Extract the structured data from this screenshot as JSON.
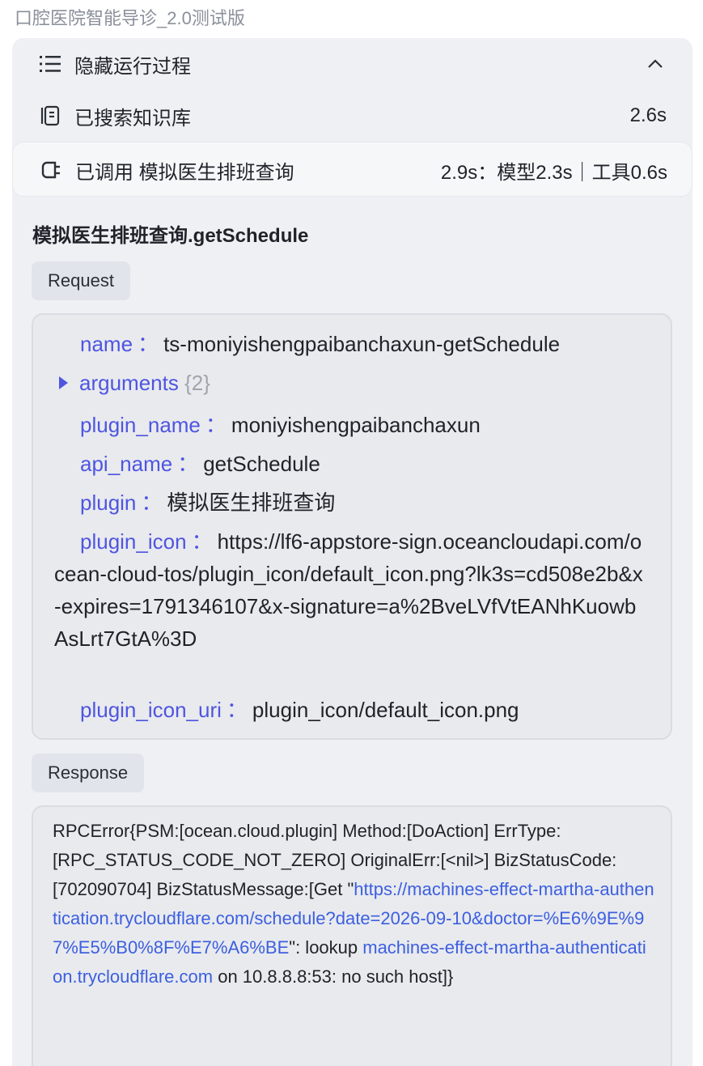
{
  "app": {
    "title": "口腔医院智能导诊_2.0测试版"
  },
  "process": {
    "hide_label": "隐藏运行过程",
    "search_label": "已搜索知识库",
    "search_time": "2.6s",
    "tool_call_label": "已调用 模拟医生排班查询",
    "tool_call_time": "2.9s：模型2.3s｜工具0.6s"
  },
  "call": {
    "function_title": "模拟医生排班查询.getSchedule",
    "request_tag": "Request",
    "response_tag": "Response",
    "request": {
      "name_key": "name",
      "name_val": "ts-moniyishengpaibanchaxun-getSchedule",
      "arguments_key": "arguments",
      "arguments_count": "{2}",
      "plugin_name_key": "plugin_name",
      "plugin_name_val": "moniyishengpaibanchaxun",
      "api_name_key": "api_name",
      "api_name_val": "getSchedule",
      "plugin_key": "plugin",
      "plugin_val": "模拟医生排班查询",
      "plugin_icon_key": "plugin_icon",
      "plugin_icon_val": "https://lf6-appstore-sign.oceancloudapi.com/ocean-cloud-tos/plugin_icon/default_icon.png?lk3s=cd508e2b&x-expires=1791346107&x-signature=a%2BveLVfVtEANhKuowbAsLrt7GtA%3D",
      "plugin_icon_uri_key": "plugin_icon_uri",
      "plugin_icon_uri_val": "plugin_icon/default_icon.png",
      "colon": "："
    },
    "response": {
      "part1": "RPCError{PSM:[ocean.cloud.plugin] Method:[DoAction] ErrType:[RPC_STATUS_CODE_NOT_ZERO] OriginalErr:[<nil>] BizStatusCode:[702090704] BizStatusMessage:[Get \"",
      "link1": "https://machines-effect-martha-authentication.trycloudflare.com/schedule?date=2026-09-10&doctor=%E6%9E%97%E5%B0%8F%E7%A6%BE",
      "part2": "\": lookup ",
      "link2": "machines-effect-martha-authentication.trycloudflare.com",
      "part3": " on 10.8.8.8:53: no such host]}"
    }
  }
}
